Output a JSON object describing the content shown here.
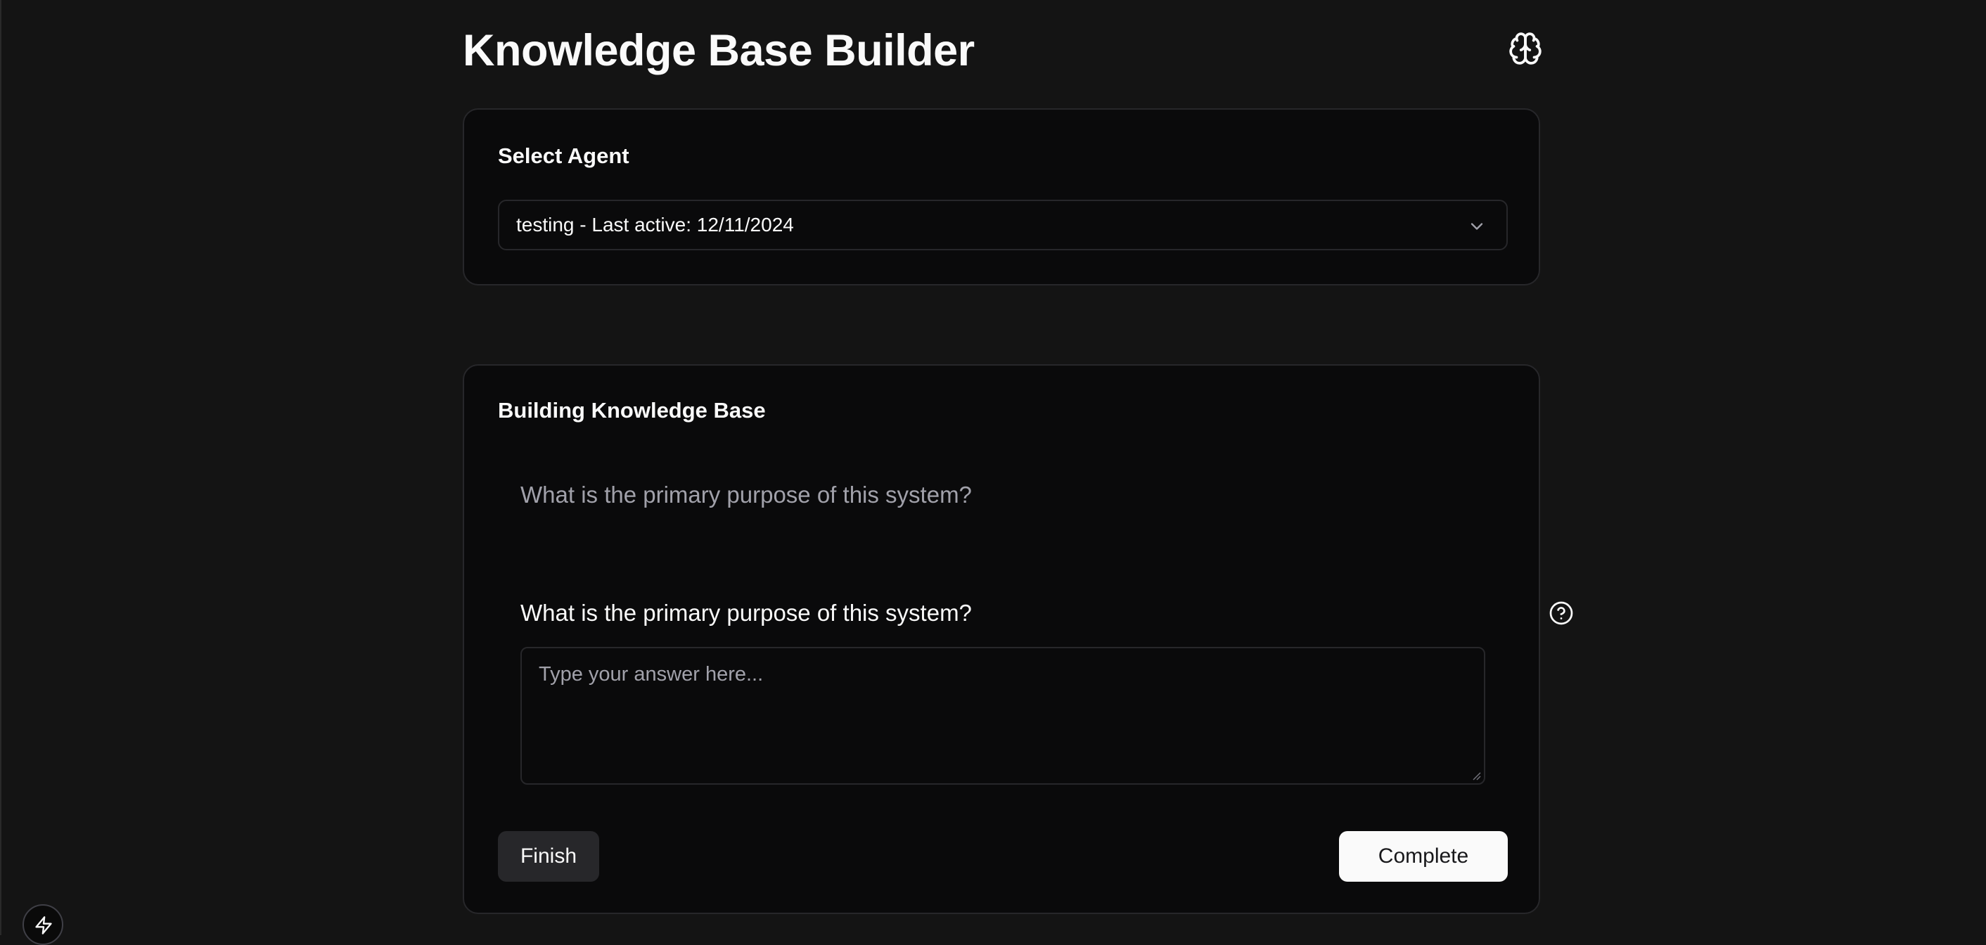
{
  "page": {
    "title": "Knowledge Base Builder",
    "header_icon": "brain-icon"
  },
  "agent_card": {
    "title": "Select Agent",
    "selected_agent": "testing - Last active: 12/11/2024"
  },
  "kb_card": {
    "title": "Building Knowledge Base",
    "previous_question": "What is the primary purpose of this system?",
    "current_question": "What is the primary purpose of this system?",
    "answer_value": "",
    "answer_placeholder": "Type your answer here...",
    "finish_label": "Finish",
    "complete_label": "Complete"
  },
  "floating_button": {
    "icon": "bolt-icon"
  },
  "colors": {
    "background": "#141414",
    "card": "#0a0a0b",
    "border": "#27272a",
    "primary_button": "#fafafa",
    "secondary_button": "#27272a"
  }
}
